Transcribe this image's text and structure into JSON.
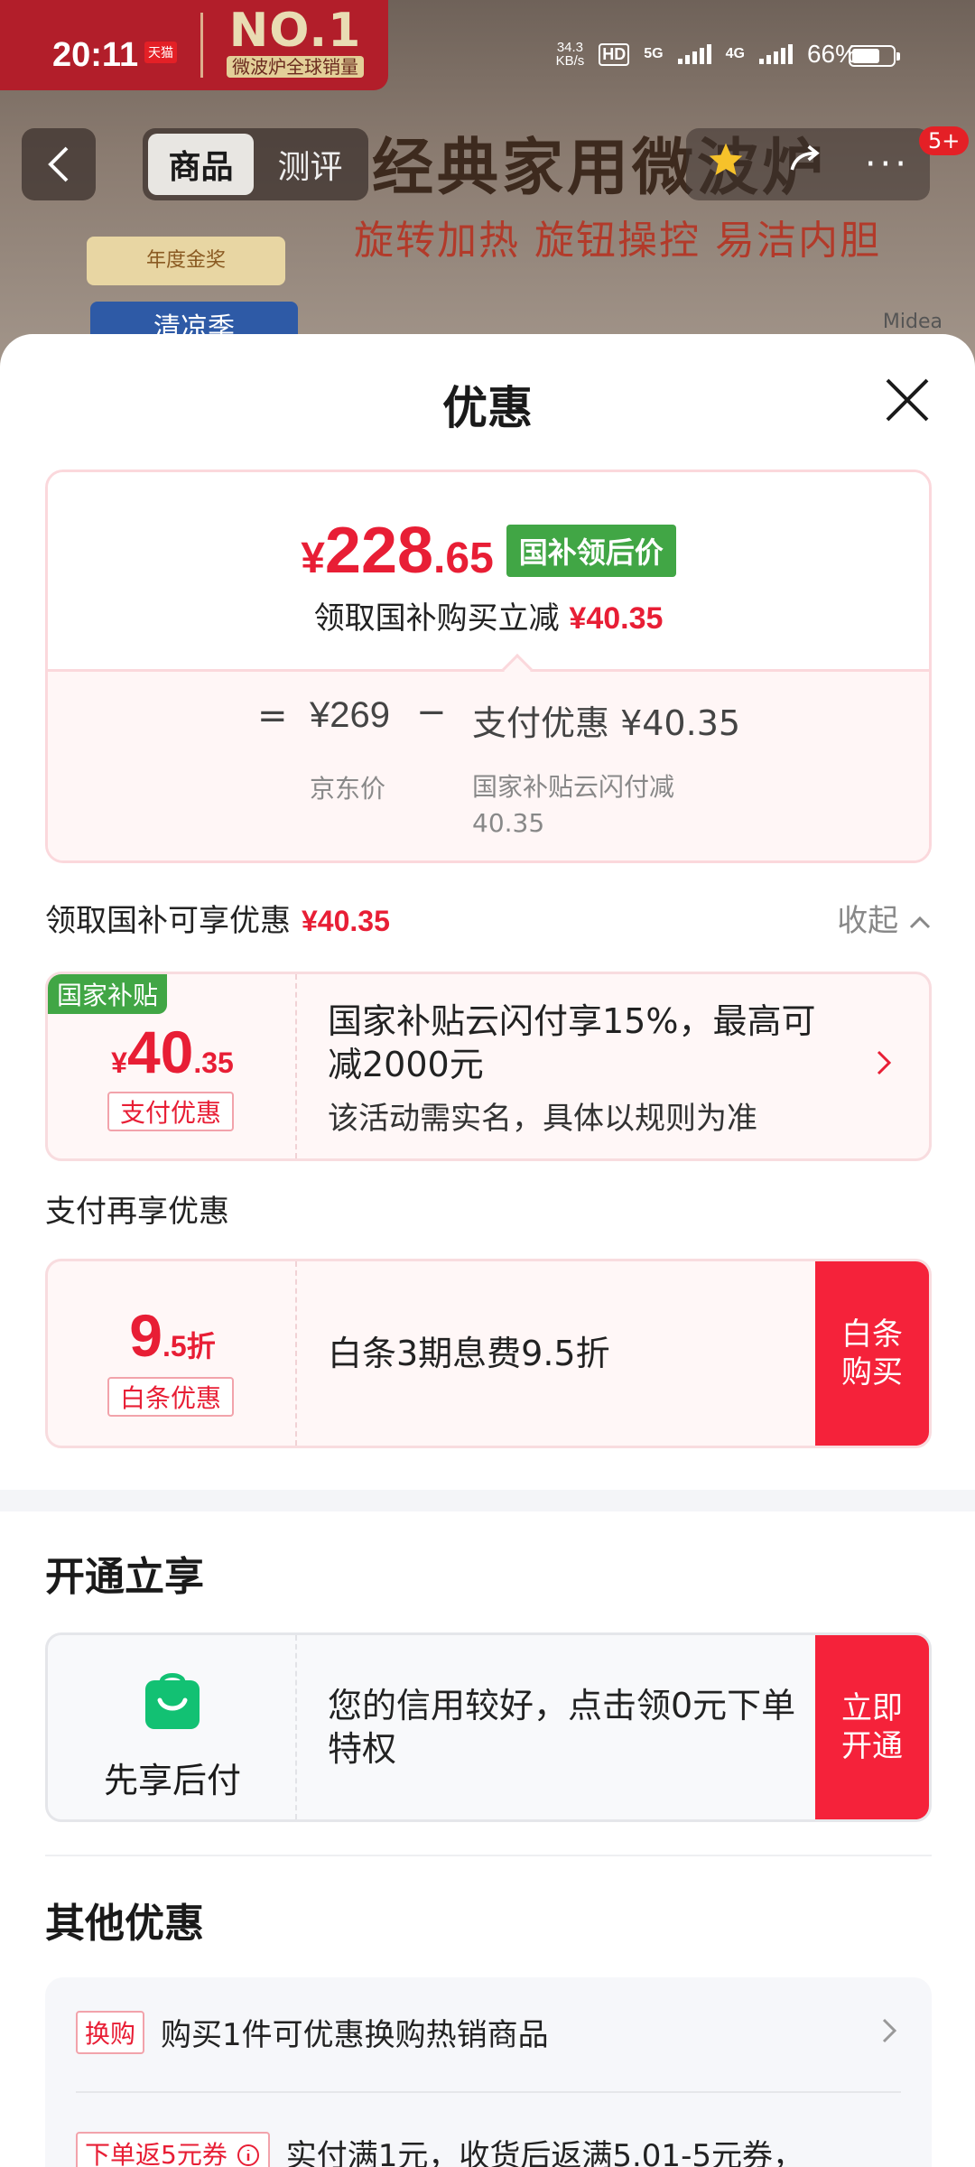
{
  "status_bar": {
    "time": "20:11",
    "app_tag": "天猫",
    "net_speed": "34.3",
    "net_unit": "KB/s",
    "hd": "HD",
    "sim1": "5G",
    "sim2": "4G",
    "battery": "66%"
  },
  "background": {
    "banner_big": "NO.1",
    "banner_small": "微波炉全球销量",
    "headline": "经典家用微波炉",
    "subline": "旋转加热 旋钮操控 易洁内胆",
    "award": "年度金奖",
    "cool": "清凉季",
    "brand": "Midea",
    "nav_tabs": [
      "商品",
      "测评"
    ],
    "badge": "5+"
  },
  "sheet": {
    "title": "优惠",
    "price": {
      "symbol": "¥",
      "integer": "228",
      "decimal": ".65",
      "badge": "国补领后价",
      "note_text": "领取国补购买立减",
      "note_amount": "¥40.35"
    },
    "calc": {
      "eq": "=",
      "jd_price": "¥269",
      "minus": "−",
      "pay_discount": "支付优惠 ¥40.35",
      "jd_label": "京东价",
      "pay_label": "国家补贴云闪付减40.35"
    },
    "section1": {
      "title": "领取国补可享优惠",
      "amount": "¥40.35",
      "collapse": "收起"
    },
    "coupon1": {
      "corner": "国家补贴",
      "symbol": "¥",
      "integer": "40",
      "decimal": ".35",
      "tag": "支付优惠",
      "desc": "国家补贴云闪付享15%，最高可减2000元",
      "desc2": "该活动需实名，具体以规则为准"
    },
    "section2_title": "支付再享优惠",
    "coupon2": {
      "integer": "9",
      "decimal": ".5折",
      "tag": "白条优惠",
      "desc": "白条3期息费9.5折",
      "cta": "白条购买"
    },
    "section3_title": "开通立享",
    "coupon3": {
      "label": "先享后付",
      "desc": "您的信用较好，点击领0元下单特权",
      "cta": "立即开通"
    },
    "section4_title": "其他优惠",
    "other": [
      {
        "tag": "换购",
        "text": "购买1件可优惠换购热销商品"
      },
      {
        "tag": "下单返5元券",
        "text": "实付满1元，收货后返满5.01-5元券，"
      }
    ]
  }
}
